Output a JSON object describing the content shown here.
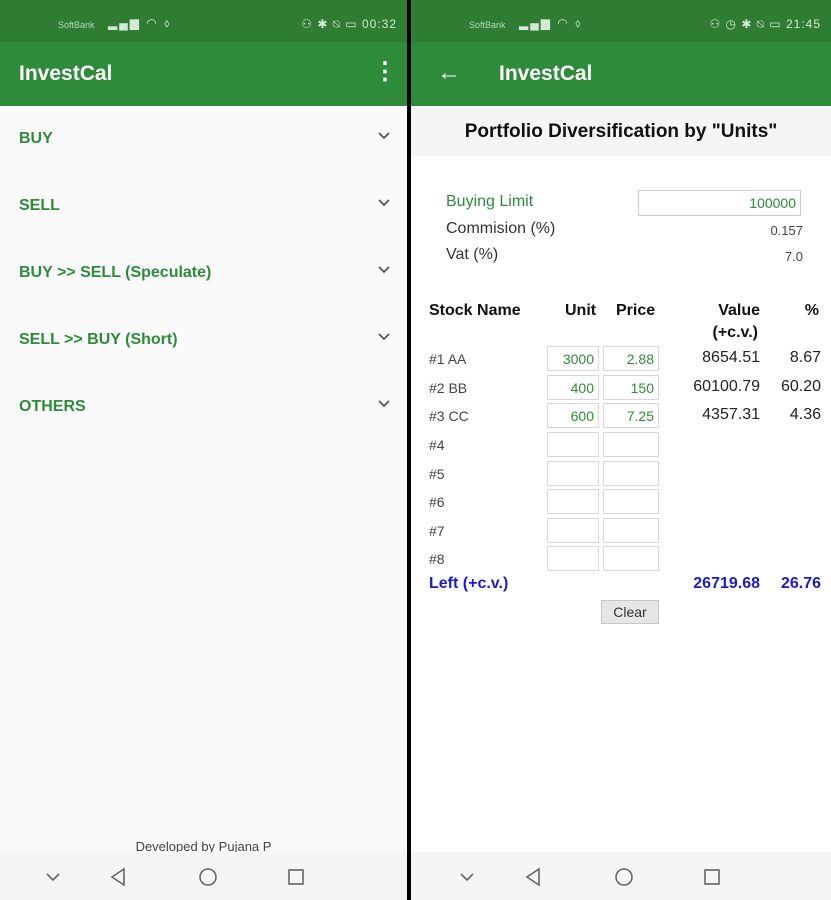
{
  "left_phone": {
    "status": {
      "carrier": "SoftBank",
      "time": "00:32"
    },
    "appbar": {
      "title": "InvestCal"
    },
    "menu": [
      {
        "label": "BUY"
      },
      {
        "label": "SELL"
      },
      {
        "label": "BUY >> SELL (Speculate)"
      },
      {
        "label": "SELL >> BUY (Short)"
      },
      {
        "label": "OTHERS"
      }
    ],
    "footer": "Developed by Pujana P"
  },
  "right_phone": {
    "status": {
      "carrier": "SoftBank",
      "time": "21:45"
    },
    "appbar": {
      "title": "InvestCal"
    },
    "section_title": "Portfolio Diversification by \"Units\"",
    "form": {
      "buying_limit_label": "Buying Limit",
      "buying_limit_value": "100000",
      "commission_label": "Commision (%)",
      "commission_value": "0.157",
      "vat_label": "Vat (%)",
      "vat_value": "7.0"
    },
    "table": {
      "headers": {
        "name": "Stock Name",
        "unit": "Unit",
        "price": "Price",
        "value_line1": "Value",
        "value_line2": "(+c.v.)",
        "pct": "%"
      },
      "rows": [
        {
          "name": "#1 AA",
          "unit": "3000",
          "price": "2.88",
          "value": "8654.51",
          "pct": "8.67"
        },
        {
          "name": "#2 BB",
          "unit": "400",
          "price": "150",
          "value": "60100.79",
          "pct": "60.20"
        },
        {
          "name": "#3 CC",
          "unit": "600",
          "price": "7.25",
          "value": "4357.31",
          "pct": "4.36"
        },
        {
          "name": "#4",
          "unit": "",
          "price": "",
          "value": "",
          "pct": ""
        },
        {
          "name": "#5",
          "unit": "",
          "price": "",
          "value": "",
          "pct": ""
        },
        {
          "name": "#6",
          "unit": "",
          "price": "",
          "value": "",
          "pct": ""
        },
        {
          "name": "#7",
          "unit": "",
          "price": "",
          "value": "",
          "pct": ""
        },
        {
          "name": "#8",
          "unit": "",
          "price": "",
          "value": "",
          "pct": ""
        }
      ],
      "left_row": {
        "label": "Left (+c.v.)",
        "value": "26719.68",
        "pct": "26.76"
      }
    },
    "clear_label": "Clear"
  },
  "colors": {
    "appbar": "#2e8b3a",
    "statusbar": "#2e7d32",
    "accent_green": "#2e8b3a",
    "left_blue": "#1a1ad6"
  }
}
